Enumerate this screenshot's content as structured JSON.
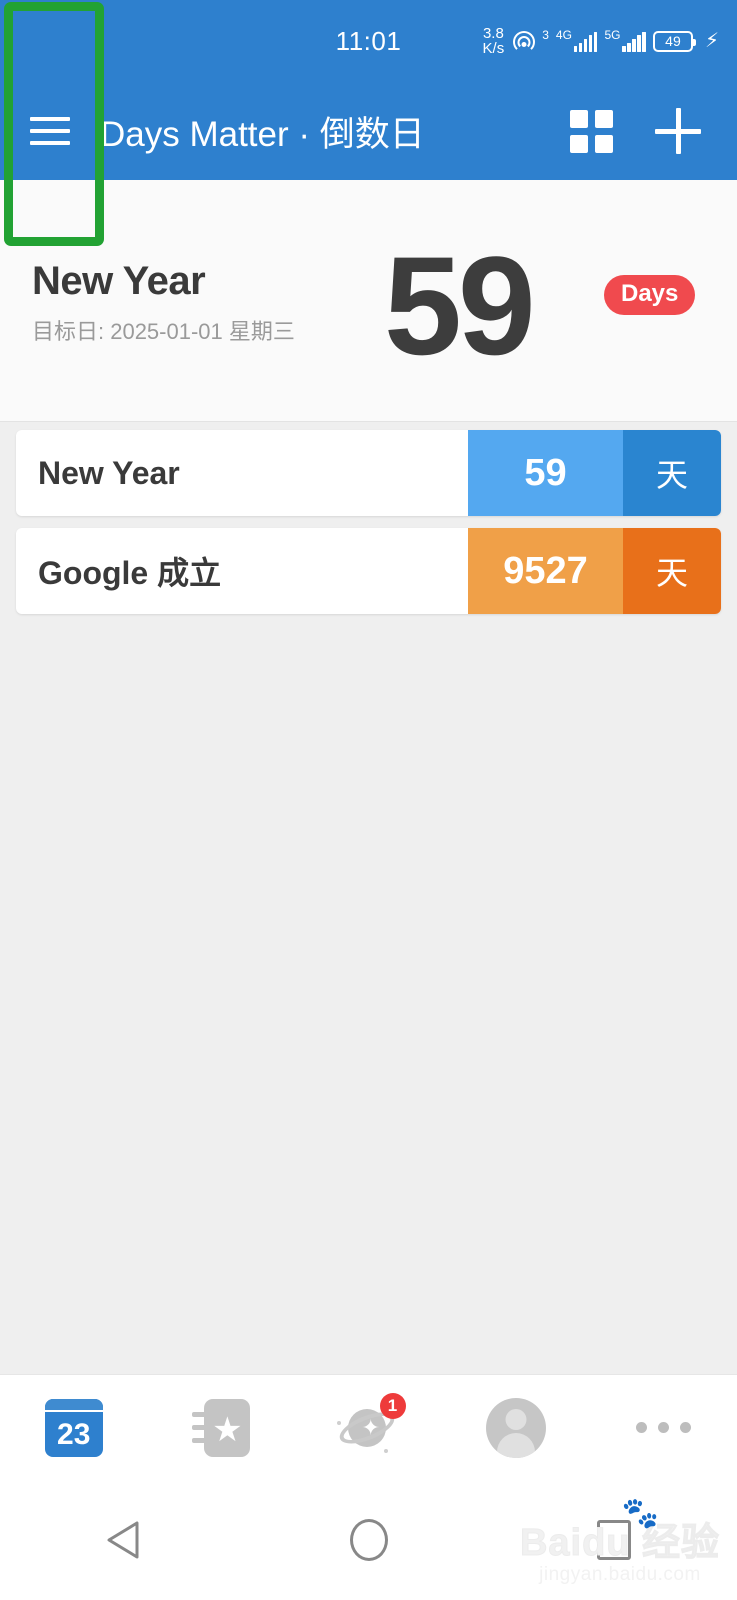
{
  "status_bar": {
    "clock": "11:01",
    "net_speed_value": "3.8",
    "net_speed_unit": "K/s",
    "hotspot_count": "3",
    "sim1_network": "4G",
    "sim2_network": "5G",
    "battery_level": "49",
    "battery_charging_icon": "bolt-icon"
  },
  "app_bar": {
    "menu_icon": "hamburger-menu-icon",
    "title": "Days Matter · 倒数日",
    "grid_icon": "grid-view-icon",
    "add_icon": "plus-icon"
  },
  "featured": {
    "title": "New Year",
    "subtitle": "目标日: 2025-01-01 星期三",
    "count": "59",
    "badge_label": "Days",
    "badge_color": "#f04a4e"
  },
  "list": {
    "items": [
      {
        "title": "New Year",
        "count": "59",
        "unit": "天",
        "count_bg": "#54a8f0",
        "unit_bg": "#2a85d0"
      },
      {
        "title": "Google 成立",
        "count": "9527",
        "unit": "天",
        "count_bg": "#f0a048",
        "unit_bg": "#e8701a"
      }
    ]
  },
  "tab_bar": {
    "items": [
      {
        "name": "calendar-tab",
        "icon": "calendar-icon",
        "day": "23",
        "badge": ""
      },
      {
        "name": "collection-tab",
        "icon": "notebook-star-icon",
        "badge": ""
      },
      {
        "name": "discover-tab",
        "icon": "planet-icon",
        "badge": "1"
      },
      {
        "name": "profile-tab",
        "icon": "avatar-icon",
        "badge": ""
      },
      {
        "name": "more-tab",
        "icon": "more-dots-icon",
        "badge": ""
      }
    ]
  },
  "nav_bar": {
    "back_icon": "back-triangle-icon",
    "home_icon": "home-circle-icon",
    "recents_icon": "recents-square-icon"
  },
  "watermark": {
    "main": "Baidu 经验",
    "sub": "jingyan.baidu.com"
  },
  "annotation": {
    "shape": "rectangle",
    "color": "#22a233",
    "target": "hamburger-menu-icon"
  },
  "theme": {
    "primary": "#2e80ce",
    "page_bg": "#efefef",
    "card_bg": "#ffffff"
  }
}
